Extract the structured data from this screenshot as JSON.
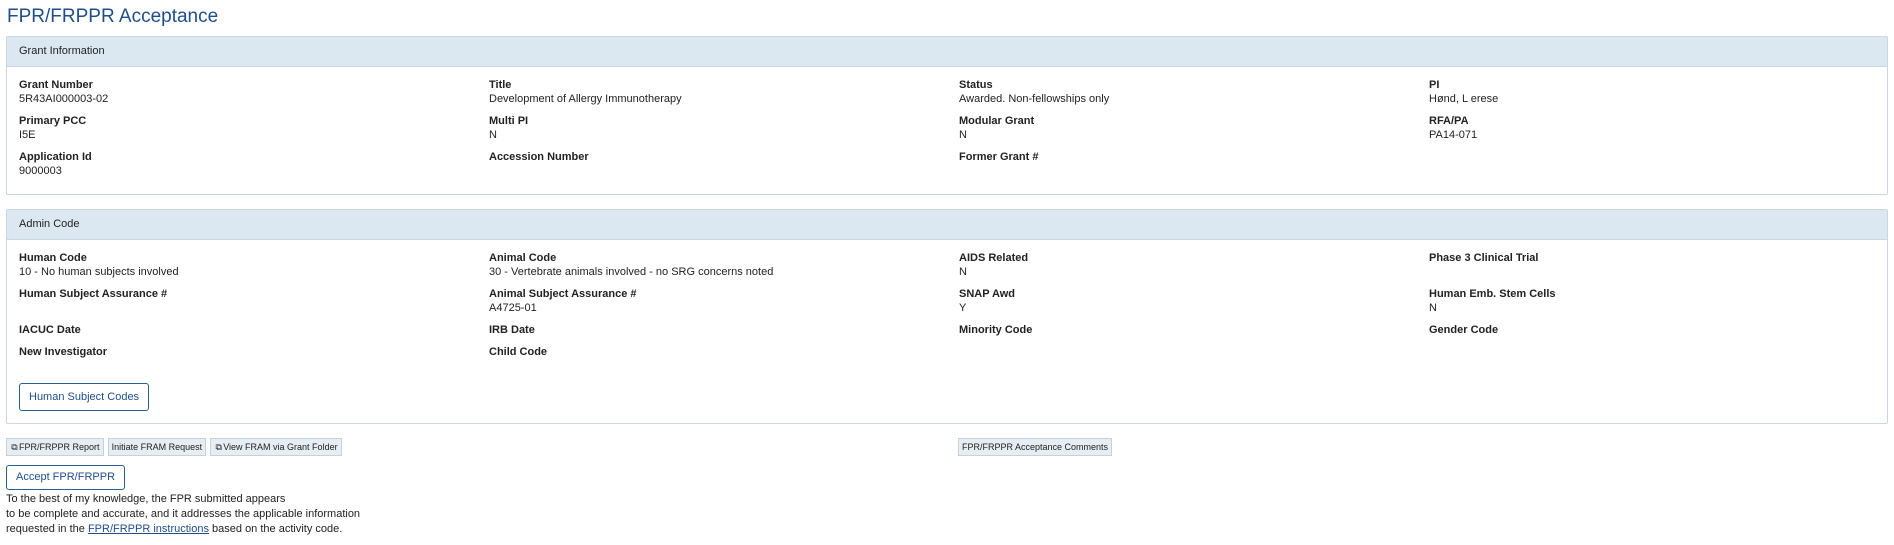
{
  "page": {
    "title": "FPR/FRPPR Acceptance"
  },
  "grant_info": {
    "heading": "Grant Information",
    "fields": [
      {
        "label": "Grant Number",
        "value": "5R43AI000003-02"
      },
      {
        "label": "Title",
        "value": "Development of Allergy Immunotherapy"
      },
      {
        "label": "Status",
        "value": "Awarded. Non-fellowships only"
      },
      {
        "label": "PI",
        "value": "Hønd, L erese"
      },
      {
        "label": "Primary PCC",
        "value": "I5E"
      },
      {
        "label": "Multi PI",
        "value": "N"
      },
      {
        "label": "Modular Grant",
        "value": "N"
      },
      {
        "label": "RFA/PA",
        "value": "PA14-071"
      },
      {
        "label": "Application Id",
        "value": "9000003"
      },
      {
        "label": "Accession Number",
        "value": ""
      },
      {
        "label": "Former Grant #",
        "value": ""
      },
      {
        "label": "",
        "value": ""
      }
    ]
  },
  "admin_code": {
    "heading": "Admin Code",
    "fields": [
      {
        "label": "Human Code",
        "value": "10 - No human subjects involved"
      },
      {
        "label": "Animal Code",
        "value": "30 - Vertebrate animals involved - no SRG concerns noted"
      },
      {
        "label": "AIDS Related",
        "value": "N"
      },
      {
        "label": "Phase 3 Clinical Trial",
        "value": ""
      },
      {
        "label": "Human Subject Assurance #",
        "value": ""
      },
      {
        "label": "Animal Subject Assurance #",
        "value": "A4725-01"
      },
      {
        "label": "SNAP Awd",
        "value": "Y"
      },
      {
        "label": "Human Emb. Stem Cells",
        "value": "N"
      },
      {
        "label": "IACUC Date",
        "value": ""
      },
      {
        "label": "IRB Date",
        "value": ""
      },
      {
        "label": "Minority Code",
        "value": ""
      },
      {
        "label": "Gender Code",
        "value": ""
      },
      {
        "label": "New Investigator",
        "value": ""
      },
      {
        "label": "Child Code",
        "value": ""
      }
    ],
    "human_subject_codes_button": "Human Subject Codes"
  },
  "actions": {
    "fpr_report": "FPR/FRPPR Report",
    "initiate_fram": "Initiate FRAM Request",
    "view_fram": "View FRAM via Grant Folder",
    "comments": "FPR/FRPPR Acceptance Comments",
    "accept": "Accept FPR/FRPPR"
  },
  "notice": {
    "line1": "To the best of my knowledge, the FPR submitted appears",
    "line2": "to be complete and accurate, and it addresses the applicable information",
    "line3_prefix": "requested in the ",
    "link_text": "FPR/FRPPR instructions",
    "line3_suffix": " based on the activity code."
  },
  "icons": {
    "external_link": "external-link-icon"
  },
  "colors": {
    "title": "#1f4e8c",
    "panel_heading_bg": "#dbe8f2",
    "button_border": "#2a5e92"
  }
}
